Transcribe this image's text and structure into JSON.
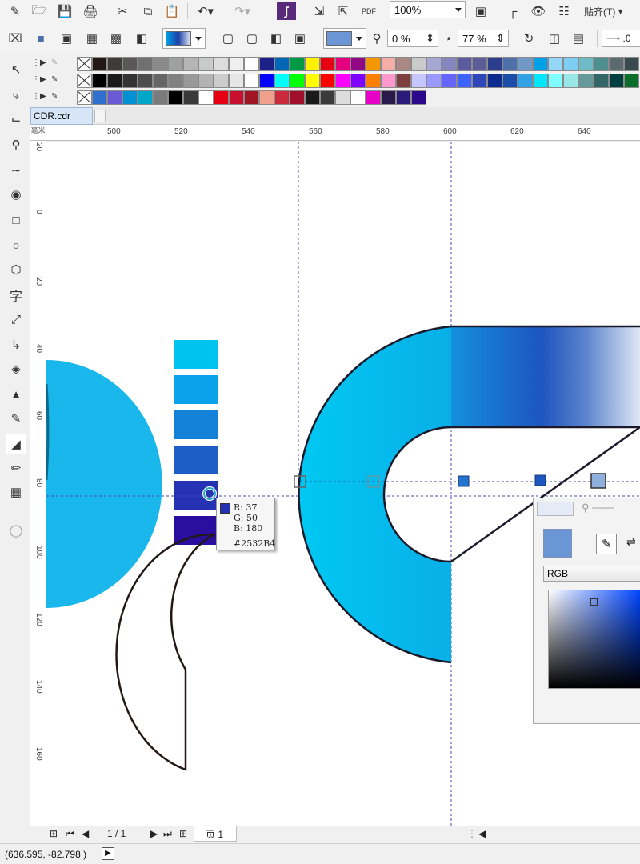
{
  "toolbar": {
    "zoom_value": "100%",
    "snap_label": "贴齐(T)"
  },
  "fill_toolbar": {
    "transparency_value": "0 %",
    "midpoint_value": "77 %",
    "angle_value": ".0"
  },
  "palettes": {
    "row1": [
      "none",
      "#231815",
      "#3e3a39",
      "#595757",
      "#727171",
      "#898989",
      "#9fa0a0",
      "#b5b5b6",
      "#c9caca",
      "#dcdddd",
      "#efefef",
      "#ffffff",
      "#1d2088",
      "#0068b7",
      "#009944",
      "#fff100",
      "#e60012",
      "#e4007f",
      "#920783",
      "#f39800",
      "#f6ada5",
      "#aa8984",
      "#c9caca",
      "#a7a8d6",
      "#8686bf",
      "#5a5c9f",
      "#5e5c98",
      "#2c3d8b",
      "#4e6fa9",
      "#6f98c6",
      "#00a0e9",
      "#94d6f7",
      "#7ecef4",
      "#6cbbc6",
      "#4f8f8f",
      "#5b6a6f",
      "#3a4b4e"
    ],
    "row2": [
      "none",
      "#000000",
      "#1a1a1a",
      "#333333",
      "#4d4d4d",
      "#666666",
      "#808080",
      "#999999",
      "#b3b3b3",
      "#cccccc",
      "#e6e6e6",
      "#ffffff",
      "#0000ff",
      "#00ffff",
      "#00ff00",
      "#ffff00",
      "#ff0000",
      "#ff00ff",
      "#7f00ff",
      "#ff7f00",
      "#ff99cc",
      "#7f3f3f",
      "#c6c6ff",
      "#9999ff",
      "#6666ff",
      "#3d62ff",
      "#2d46b9",
      "#0d2a8f",
      "#1a4ea8",
      "#33a1e6",
      "#00e6ff",
      "#7fffff",
      "#99e6e6",
      "#669999",
      "#336666",
      "#004040",
      "#0b6e2a"
    ],
    "row3": [
      "none",
      "#2f6fd0",
      "#6a5bd4",
      "#0091d4",
      "#00a6c8",
      "#7a7a7a",
      "#000000",
      "#3a3a3a",
      "#ffffff",
      "#e60012",
      "#c8102e",
      "#a01424",
      "#f0a08c",
      "#cc2a3c",
      "#a0102c",
      "#1a1a1a",
      "#3a3a3a",
      "#dddddd",
      "#ffffff",
      "#e600c8",
      "#2a1a4a",
      "#2a1a7a",
      "#2a0a8a"
    ]
  },
  "document": {
    "tab_name": "CDR.cdr"
  },
  "rulers": {
    "h_labels": [
      "500",
      "520",
      "540",
      "560",
      "580",
      "600",
      "620",
      "640"
    ],
    "v_labels": [
      "20",
      "0",
      "20",
      "40",
      "60",
      "80",
      "100",
      "120",
      "140",
      "160"
    ],
    "corner_label": "毫米"
  },
  "swatch_column": [
    "#00c4f0",
    "#0aa2e8",
    "#1482d8",
    "#1e5dc6",
    "#2532b4",
    "#2a0f9e"
  ],
  "color_tooltip": {
    "r_line": "R: 37",
    "g_line": "G: 50",
    "b_line": "B: 180",
    "hex": "#2532B4",
    "chip_color": "#2532B4"
  },
  "color_docker": {
    "swatch_color": "#6b96d6",
    "model": "RGB"
  },
  "pagebar": {
    "page_count": "1 / 1",
    "page_tab": "页 1"
  },
  "status": {
    "coordinates": "(636.595, -82.798 )"
  }
}
